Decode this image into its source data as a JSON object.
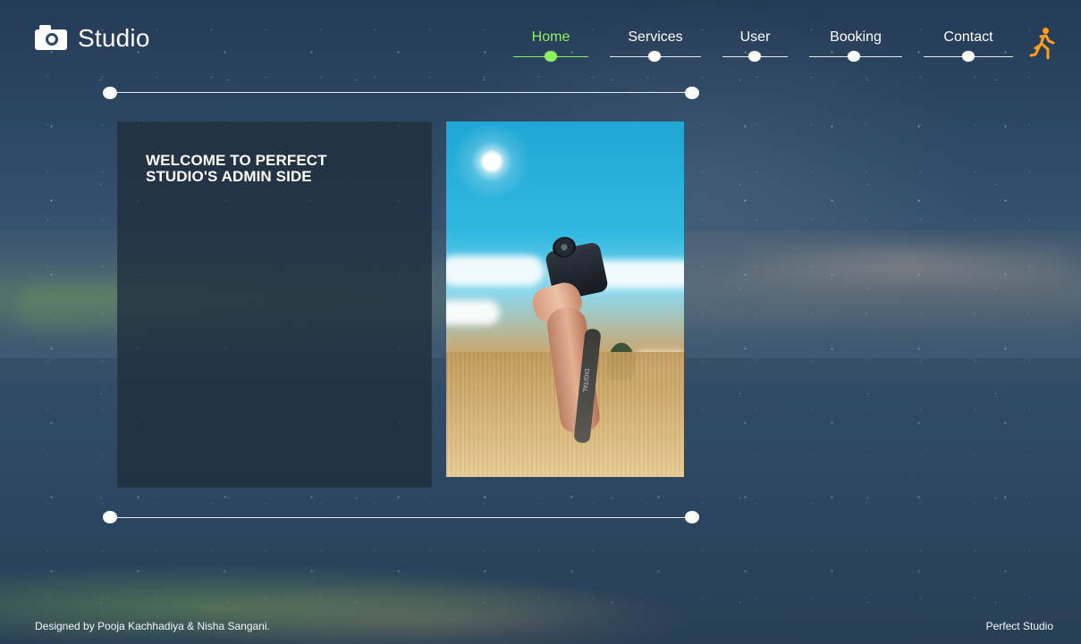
{
  "brand": {
    "name": "Studio",
    "icon": "camera-icon"
  },
  "navigation": {
    "items": [
      {
        "label": "Home",
        "active": true
      },
      {
        "label": "Services",
        "active": false
      },
      {
        "label": "User",
        "active": false
      },
      {
        "label": "Booking",
        "active": false
      },
      {
        "label": "Contact",
        "active": false
      }
    ],
    "action_icon": "runner-icon"
  },
  "hero": {
    "title": "WELCOME TO PERFECT\nSTUDIO'S ADMIN SIDE",
    "image_strap_text": "DIGITAL"
  },
  "footer": {
    "left": "Designed by Pooja Kachhadiya & Nisha Sangani.",
    "right": "Perfect Studio"
  },
  "colors": {
    "active_nav": "#8ff05f",
    "runner": "#ff9f1a",
    "text": "#ffffff"
  }
}
